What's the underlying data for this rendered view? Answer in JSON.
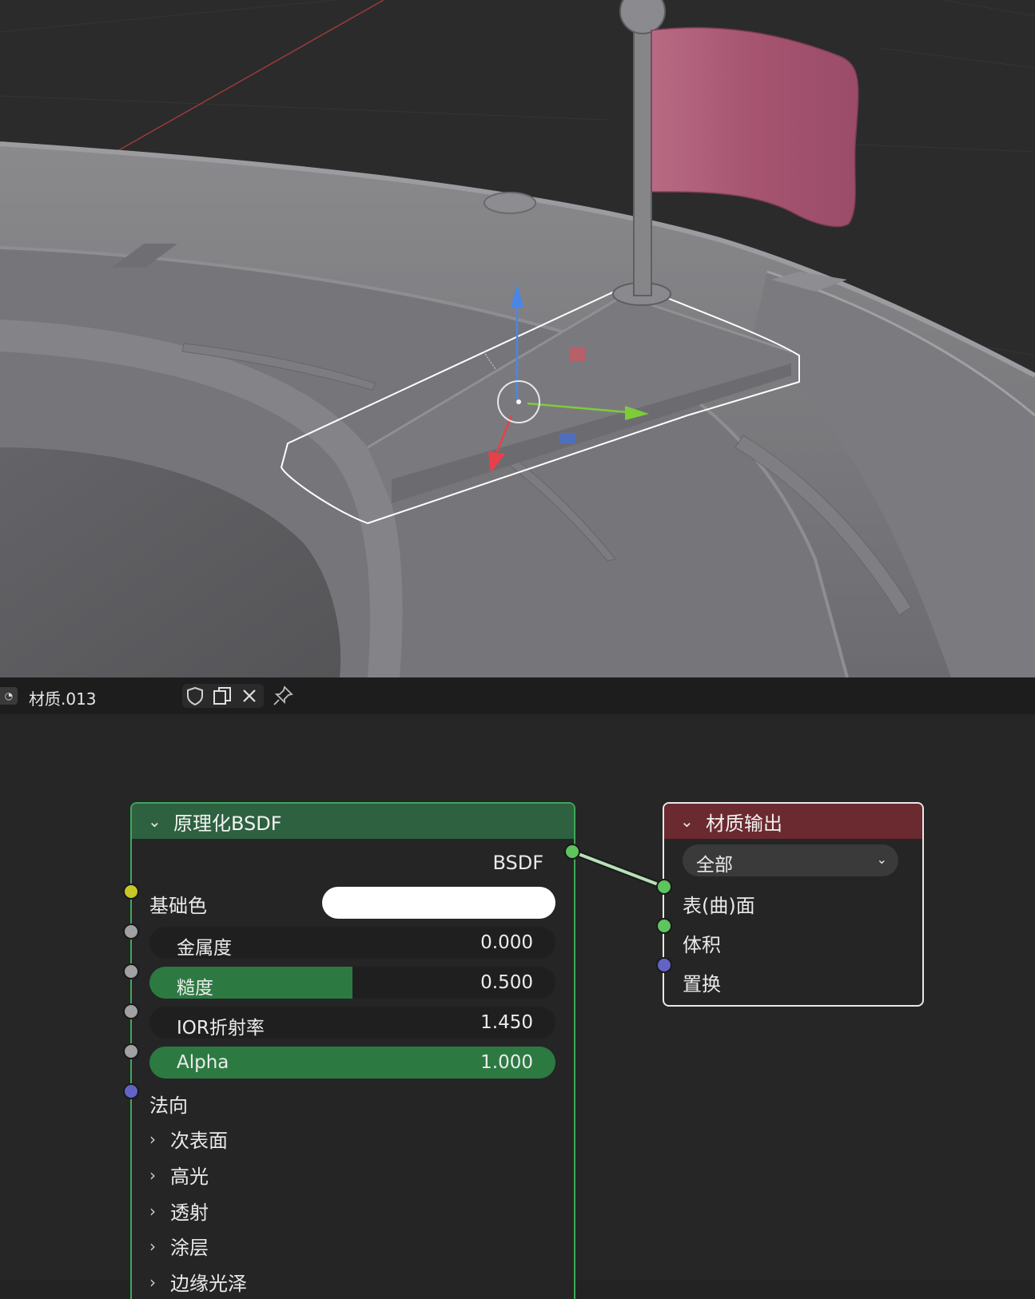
{
  "header": {
    "browse_icon": "sphere-dropdown-icon",
    "material_name": "材质.013",
    "icons": [
      "fake-user-shield-icon",
      "duplicate-icon",
      "unlink-x-icon",
      "pin-icon"
    ]
  },
  "bsdf_node": {
    "title": "原理化BSDF",
    "output_label": "BSDF",
    "base_color_label": "基础色",
    "base_color_value": "#ffffff",
    "fields": [
      {
        "label": "金属度",
        "value": "0.000",
        "fill": 0.0
      },
      {
        "label": "糙度",
        "value": "0.500",
        "fill": 0.5
      },
      {
        "label": "IOR折射率",
        "value": "1.450",
        "fill": 0.0
      },
      {
        "label": "Alpha",
        "value": "1.000",
        "fill": 1.0
      }
    ],
    "normal_label": "法向",
    "panels": [
      "次表面",
      "高光",
      "透射",
      "涂层",
      "边缘光泽"
    ]
  },
  "output_node": {
    "title": "材质输出",
    "target": "全部",
    "inputs": [
      "表(曲)面",
      "体积",
      "置换"
    ]
  },
  "colors": {
    "shader_socket": "#5ec45e",
    "color_socket": "#c7c729",
    "float_socket": "#a1a1a1",
    "vector_socket": "#6363c7",
    "bsdf_header": "#2d6140",
    "output_header": "#6b2a30",
    "flag": "#b05a74",
    "selection_outline": "#ffffff"
  }
}
